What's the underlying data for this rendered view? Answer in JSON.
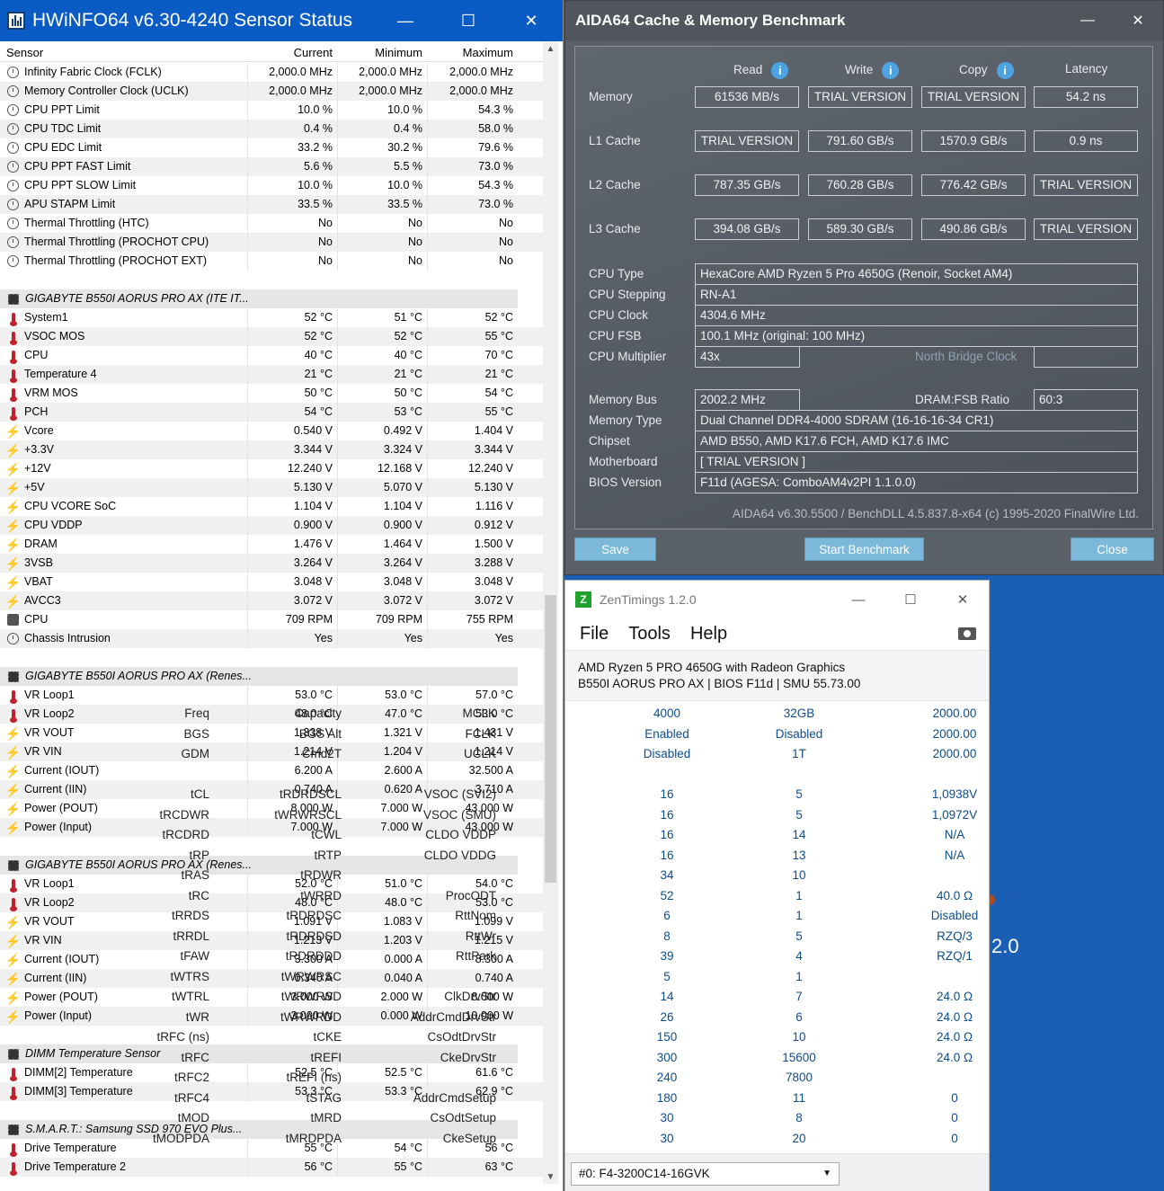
{
  "hwinfo": {
    "title": "HWiNFO64 v6.30-4240 Sensor Status",
    "headers": {
      "sensor": "Sensor",
      "current": "Current",
      "minimum": "Minimum",
      "maximum": "Maximum"
    },
    "rows": [
      {
        "t": "s",
        "icon": "clock-icon",
        "label": "Infinity Fabric Clock (FCLK)",
        "cur": "2,000.0 MHz",
        "min": "2,000.0 MHz",
        "max": "2,000.0 MHz"
      },
      {
        "t": "s",
        "icon": "clock-icon",
        "label": "Memory Controller Clock (UCLK)",
        "cur": "2,000.0 MHz",
        "min": "2,000.0 MHz",
        "max": "2,000.0 MHz"
      },
      {
        "t": "s",
        "icon": "clock-icon",
        "label": "CPU PPT Limit",
        "cur": "10.0 %",
        "min": "10.0 %",
        "max": "54.3 %"
      },
      {
        "t": "s",
        "icon": "clock-icon",
        "label": "CPU TDC Limit",
        "cur": "0.4 %",
        "min": "0.4 %",
        "max": "58.0 %"
      },
      {
        "t": "s",
        "icon": "clock-icon",
        "label": "CPU EDC Limit",
        "cur": "33.2 %",
        "min": "30.2 %",
        "max": "79.6 %"
      },
      {
        "t": "s",
        "icon": "clock-icon",
        "label": "CPU PPT FAST Limit",
        "cur": "5.6 %",
        "min": "5.5 %",
        "max": "73.0 %"
      },
      {
        "t": "s",
        "icon": "clock-icon",
        "label": "CPU PPT SLOW Limit",
        "cur": "10.0 %",
        "min": "10.0 %",
        "max": "54.3 %"
      },
      {
        "t": "s",
        "icon": "clock-icon",
        "label": "APU STAPM Limit",
        "cur": "33.5 %",
        "min": "33.5 %",
        "max": "73.0 %"
      },
      {
        "t": "s",
        "icon": "clock-icon",
        "label": "Thermal Throttling (HTC)",
        "cur": "No",
        "min": "No",
        "max": "No"
      },
      {
        "t": "s",
        "icon": "clock-icon",
        "label": "Thermal Throttling (PROCHOT CPU)",
        "cur": "No",
        "min": "No",
        "max": "No"
      },
      {
        "t": "s",
        "icon": "clock-icon",
        "label": "Thermal Throttling (PROCHOT EXT)",
        "cur": "No",
        "min": "No",
        "max": "No"
      },
      {
        "t": "gap"
      },
      {
        "t": "g",
        "label": "GIGABYTE B550I AORUS PRO AX (ITE IT..."
      },
      {
        "t": "s",
        "icon": "thermometer-icon",
        "label": "System1",
        "cur": "52 °C",
        "min": "51 °C",
        "max": "52 °C"
      },
      {
        "t": "s",
        "icon": "thermometer-icon",
        "label": "VSOC MOS",
        "cur": "52 °C",
        "min": "52 °C",
        "max": "55 °C"
      },
      {
        "t": "s",
        "icon": "thermometer-icon",
        "label": "CPU",
        "cur": "40 °C",
        "min": "40 °C",
        "max": "70 °C"
      },
      {
        "t": "s",
        "icon": "thermometer-icon",
        "label": "Temperature 4",
        "cur": "21 °C",
        "min": "21 °C",
        "max": "21 °C"
      },
      {
        "t": "s",
        "icon": "thermometer-icon",
        "label": "VRM MOS",
        "cur": "50 °C",
        "min": "50 °C",
        "max": "54 °C"
      },
      {
        "t": "s",
        "icon": "thermometer-icon",
        "label": "PCH",
        "cur": "54 °C",
        "min": "53 °C",
        "max": "55 °C"
      },
      {
        "t": "s",
        "icon": "bolt-icon",
        "label": "Vcore",
        "cur": "0.540 V",
        "min": "0.492 V",
        "max": "1.404 V"
      },
      {
        "t": "s",
        "icon": "bolt-icon",
        "label": "+3.3V",
        "cur": "3.344 V",
        "min": "3.324 V",
        "max": "3.344 V"
      },
      {
        "t": "s",
        "icon": "bolt-icon",
        "label": "+12V",
        "cur": "12.240 V",
        "min": "12.168 V",
        "max": "12.240 V"
      },
      {
        "t": "s",
        "icon": "bolt-icon",
        "label": "+5V",
        "cur": "5.130 V",
        "min": "5.070 V",
        "max": "5.130 V"
      },
      {
        "t": "s",
        "icon": "bolt-icon",
        "label": "CPU VCORE SoC",
        "cur": "1.104 V",
        "min": "1.104 V",
        "max": "1.116 V"
      },
      {
        "t": "s",
        "icon": "bolt-icon",
        "label": "CPU VDDP",
        "cur": "0.900 V",
        "min": "0.900 V",
        "max": "0.912 V"
      },
      {
        "t": "s",
        "icon": "bolt-icon",
        "label": "DRAM",
        "cur": "1.476 V",
        "min": "1.464 V",
        "max": "1.500 V"
      },
      {
        "t": "s",
        "icon": "bolt-icon",
        "label": "3VSB",
        "cur": "3.264 V",
        "min": "3.264 V",
        "max": "3.288 V"
      },
      {
        "t": "s",
        "icon": "bolt-icon",
        "label": "VBAT",
        "cur": "3.048 V",
        "min": "3.048 V",
        "max": "3.048 V"
      },
      {
        "t": "s",
        "icon": "bolt-icon",
        "label": "AVCC3",
        "cur": "3.072 V",
        "min": "3.072 V",
        "max": "3.072 V"
      },
      {
        "t": "s",
        "icon": "fan-icon",
        "label": "CPU",
        "cur": "709 RPM",
        "min": "709 RPM",
        "max": "755 RPM"
      },
      {
        "t": "s",
        "icon": "clock-icon",
        "label": "Chassis Intrusion",
        "cur": "Yes",
        "min": "Yes",
        "max": "Yes"
      },
      {
        "t": "gap"
      },
      {
        "t": "g",
        "label": "GIGABYTE B550I AORUS PRO AX (Renes..."
      },
      {
        "t": "s",
        "icon": "thermometer-icon",
        "label": "VR Loop1",
        "cur": "53.0 °C",
        "min": "53.0 °C",
        "max": "57.0 °C"
      },
      {
        "t": "s",
        "icon": "thermometer-icon",
        "label": "VR Loop2",
        "cur": "48.0 °C",
        "min": "47.0 °C",
        "max": "53.0 °C"
      },
      {
        "t": "s",
        "icon": "bolt-icon",
        "label": "VR VOUT",
        "cur": "1.338 V",
        "min": "1.321 V",
        "max": "1.431 V"
      },
      {
        "t": "s",
        "icon": "bolt-icon",
        "label": "VR VIN",
        "cur": "1.214 V",
        "min": "1.204 V",
        "max": "1.214 V"
      },
      {
        "t": "s",
        "icon": "bolt-icon",
        "label": "Current (IOUT)",
        "cur": "6.200 A",
        "min": "2.600 A",
        "max": "32.500 A"
      },
      {
        "t": "s",
        "icon": "bolt-icon",
        "label": "Current (IIN)",
        "cur": "0.740 A",
        "min": "0.620 A",
        "max": "3.710 A"
      },
      {
        "t": "s",
        "icon": "bolt-icon",
        "label": "Power (POUT)",
        "cur": "8.000 W",
        "min": "7.000 W",
        "max": "43.000 W"
      },
      {
        "t": "s",
        "icon": "bolt-icon",
        "label": "Power (Input)",
        "cur": "7.000 W",
        "min": "7.000 W",
        "max": "43.000 W"
      },
      {
        "t": "gap"
      },
      {
        "t": "g",
        "label": "GIGABYTE B550I AORUS PRO AX (Renes..."
      },
      {
        "t": "s",
        "icon": "thermometer-icon",
        "label": "VR Loop1",
        "cur": "52.0 °C",
        "min": "51.0 °C",
        "max": "54.0 °C"
      },
      {
        "t": "s",
        "icon": "thermometer-icon",
        "label": "VR Loop2",
        "cur": "48.0 °C",
        "min": "48.0 °C",
        "max": "53.0 °C"
      },
      {
        "t": "s",
        "icon": "bolt-icon",
        "label": "VR VOUT",
        "cur": "1.091 V",
        "min": "1.083 V",
        "max": "1.099 V"
      },
      {
        "t": "s",
        "icon": "bolt-icon",
        "label": "VR VIN",
        "cur": "1.213 V",
        "min": "1.203 V",
        "max": "1.215 V"
      },
      {
        "t": "s",
        "icon": "bolt-icon",
        "label": "Current (IOUT)",
        "cur": "3.300 A",
        "min": "0.000 A",
        "max": "8.300 A"
      },
      {
        "t": "s",
        "icon": "bolt-icon",
        "label": "Current (IIN)",
        "cur": "0.340 A",
        "min": "0.040 A",
        "max": "0.740 A"
      },
      {
        "t": "s",
        "icon": "bolt-icon",
        "label": "Power (POUT)",
        "cur": "3.000 W",
        "min": "2.000 W",
        "max": "8.000 W"
      },
      {
        "t": "s",
        "icon": "bolt-icon",
        "label": "Power (Input)",
        "cur": "3.000 W",
        "min": "0.000 W",
        "max": "10.000 W"
      },
      {
        "t": "gap"
      },
      {
        "t": "g",
        "label": "DIMM Temperature Sensor"
      },
      {
        "t": "s",
        "icon": "thermometer-icon",
        "label": "DIMM[2] Temperature",
        "cur": "52.5 °C",
        "min": "52.5 °C",
        "max": "61.6 °C"
      },
      {
        "t": "s",
        "icon": "thermometer-icon",
        "label": "DIMM[3] Temperature",
        "cur": "53.3 °C",
        "min": "53.3 °C",
        "max": "62.9 °C"
      },
      {
        "t": "gap"
      },
      {
        "t": "g",
        "label": "S.M.A.R.T.: Samsung SSD 970 EVO Plus..."
      },
      {
        "t": "s",
        "icon": "thermometer-icon",
        "label": "Drive Temperature",
        "cur": "55 °C",
        "min": "54 °C",
        "max": "56 °C"
      },
      {
        "t": "s",
        "icon": "thermometer-icon",
        "label": "Drive Temperature 2",
        "cur": "56 °C",
        "min": "55 °C",
        "max": "63 °C"
      }
    ]
  },
  "aida": {
    "title": "AIDA64 Cache & Memory Benchmark",
    "col_read": "Read",
    "col_write": "Write",
    "col_copy": "Copy",
    "col_latency": "Latency",
    "bench": [
      {
        "label": "Memory",
        "read": "61536 MB/s",
        "write": "TRIAL VERSION",
        "copy": "TRIAL VERSION",
        "latency": "54.2 ns"
      },
      {
        "label": "L1 Cache",
        "read": "TRIAL VERSION",
        "write": "791.60 GB/s",
        "copy": "1570.9 GB/s",
        "latency": "0.9 ns"
      },
      {
        "label": "L2 Cache",
        "read": "787.35 GB/s",
        "write": "760.28 GB/s",
        "copy": "776.42 GB/s",
        "latency": "TRIAL VERSION"
      },
      {
        "label": "L3 Cache",
        "read": "394.08 GB/s",
        "write": "589.30 GB/s",
        "copy": "490.86 GB/s",
        "latency": "TRIAL VERSION"
      }
    ],
    "cpu_type_l": "CPU Type",
    "cpu_type": "HexaCore AMD Ryzen 5 Pro 4650G  (Renoir, Socket AM4)",
    "cpu_step_l": "CPU Stepping",
    "cpu_step": "RN-A1",
    "cpu_clock_l": "CPU Clock",
    "cpu_clock": "4304.6 MHz",
    "cpu_fsb_l": "CPU FSB",
    "cpu_fsb": "100.1 MHz  (original: 100 MHz)",
    "cpu_mult_l": "CPU Multiplier",
    "cpu_mult": "43x",
    "nb_clock_l": "North Bridge Clock",
    "mem_bus_l": "Memory Bus",
    "mem_bus": "2002.2 MHz",
    "dram_ratio_l": "DRAM:FSB Ratio",
    "dram_ratio": "60:3",
    "mem_type_l": "Memory Type",
    "mem_type": "Dual Channel DDR4-4000 SDRAM  (16-16-16-34 CR1)",
    "chipset_l": "Chipset",
    "chipset": "AMD B550, AMD K17.6 FCH, AMD K17.6 IMC",
    "mobo_l": "Motherboard",
    "mobo": "[ TRIAL VERSION ]",
    "bios_l": "BIOS Version",
    "bios": "F11d  (AGESA: ComboAM4v2PI 1.1.0.0)",
    "footer": "AIDA64 v6.30.5500 / BenchDLL 4.5.837.8-x64  (c) 1995-2020 FinalWire Ltd.",
    "save": "Save",
    "start": "Start Benchmark",
    "close": "Close"
  },
  "zen": {
    "title": "ZenTimings 1.2.0",
    "menu_file": "File",
    "menu_tools": "Tools",
    "menu_help": "Help",
    "cpu": "AMD Ryzen 5 PRO 4650G with Radeon Graphics",
    "board": "B550I AORUS PRO AX | BIOS F11d | SMU 55.73.00",
    "rows": [
      [
        "Freq",
        "4000",
        "Capacity",
        "32GB",
        "MCLK",
        "2000.00"
      ],
      [
        "BGS",
        "Enabled",
        "BGS Alt",
        "Disabled",
        "FCLK",
        "2000.00"
      ],
      [
        "GDM",
        "Disabled",
        "Cmd2T",
        "1T",
        "UCLK",
        "2000.00"
      ],
      null,
      [
        "tCL",
        "16",
        "tRDRDSCL",
        "5",
        "VSOC (SVI2)",
        "1,0938V"
      ],
      [
        "tRCDWR",
        "16",
        "tWRWRSCL",
        "5",
        "VSOC (SMU)",
        "1,0972V"
      ],
      [
        "tRCDRD",
        "16",
        "tCWL",
        "14",
        "CLDO VDDP",
        "N/A"
      ],
      [
        "tRP",
        "16",
        "tRTP",
        "13",
        "CLDO VDDG",
        "N/A"
      ],
      [
        "tRAS",
        "34",
        "tRDWR",
        "10",
        "",
        ""
      ],
      [
        "tRC",
        "52",
        "tWRRD",
        "1",
        "ProcODT",
        "40.0 Ω"
      ],
      [
        "tRRDS",
        "6",
        "tRDRDSC",
        "1",
        "RttNom",
        "Disabled"
      ],
      [
        "tRRDL",
        "8",
        "tRDRDSD",
        "5",
        "RttWr",
        "RZQ/3"
      ],
      [
        "tFAW",
        "39",
        "tRDRDDD",
        "4",
        "RttPark",
        "RZQ/1"
      ],
      [
        "tWTRS",
        "5",
        "tWRWRSC",
        "1",
        "",
        ""
      ],
      [
        "tWTRL",
        "14",
        "tWRWRSD",
        "7",
        "ClkDrvStr",
        "24.0 Ω"
      ],
      [
        "tWR",
        "26",
        "tWRWRDD",
        "6",
        "AddrCmdDrvStr",
        "24.0 Ω"
      ],
      [
        "tRFC (ns)",
        "150",
        "tCKE",
        "10",
        "CsOdtDrvStr",
        "24.0 Ω"
      ],
      [
        "tRFC",
        "300",
        "tREFI",
        "15600",
        "CkeDrvStr",
        "24.0 Ω"
      ],
      [
        "tRFC2",
        "240",
        "tREFI (ns)",
        "7800",
        "",
        ""
      ],
      [
        "tRFC4",
        "180",
        "tSTAG",
        "11",
        "AddrCmdSetup",
        "0"
      ],
      [
        "tMOD",
        "30",
        "tMRD",
        "8",
        "CsOdtSetup",
        "0"
      ],
      [
        "tMODPDA",
        "30",
        "tMRDPDA",
        "20",
        "CkeSetup",
        "0"
      ]
    ],
    "module": "#0: F4-3200C14-16GVK"
  },
  "background": {
    "text": "2.0"
  }
}
